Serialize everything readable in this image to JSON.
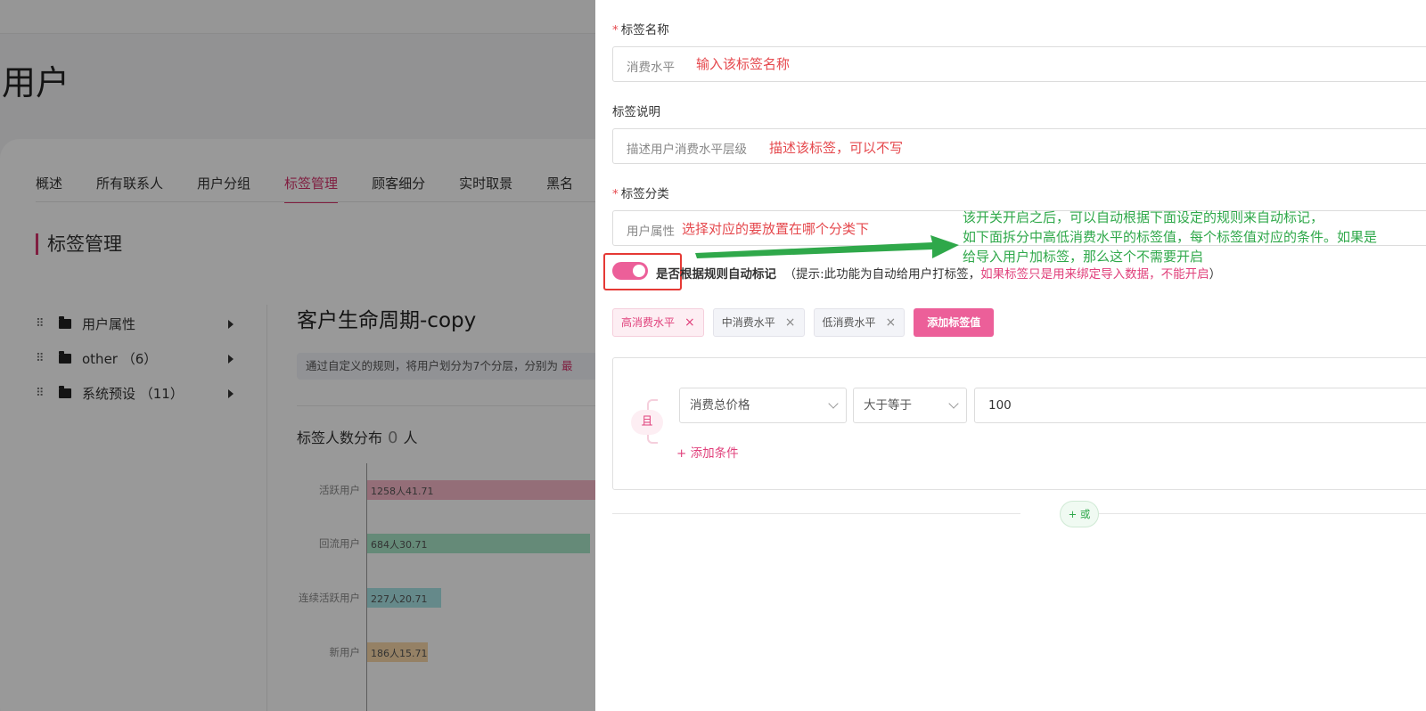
{
  "background": {
    "page_title": "用户",
    "tabs": [
      "概述",
      "所有联系人",
      "用户分组",
      "标签管理",
      "顾客细分",
      "实时取景",
      "黑名"
    ],
    "active_tab": "标签管理",
    "section_title": "标签管理",
    "tree": [
      {
        "label": "用户属性"
      },
      {
        "label": "other （6）"
      },
      {
        "label": "系统预设 （11）"
      }
    ],
    "detail_title": "客户生命周期-copy",
    "detail_desc_prefix": "通过自定义的规则，将用户划分为7个分层，分别为",
    "detail_desc_suffix": "最",
    "dist_label": "标签人数分布",
    "dist_count": "0",
    "dist_unit": "人"
  },
  "chart_data": {
    "type": "bar",
    "orientation": "horizontal",
    "categories": [
      "活跃用户",
      "回流用户",
      "连续活跃用户",
      "新用户"
    ],
    "values": [
      1258,
      684,
      227,
      186
    ],
    "data_labels": [
      "1258人41.71",
      "684人30.71",
      "227人20.71",
      "186人15.71"
    ],
    "colors": [
      "#f7b8c8",
      "#a8e6c9",
      "#a8e4e6",
      "#f8d7a8"
    ]
  },
  "drawer": {
    "name_label": "标签名称",
    "name_placeholder": "消费水平",
    "name_note": "输入该标签名称",
    "desc_label": "标签说明",
    "desc_placeholder": "描述用户消费水平层级",
    "desc_note": "描述该标签，可以不写",
    "category_label": "标签分类",
    "category_value": "用户属性",
    "category_note": "选择对应的要放置在哪个分类下",
    "green_note": [
      "该开关开启之后，可以自动根据下面设定的规则来自动标记，",
      "如下面拆分中高低消费水平的标签值，每个标签值对应的条件。如果是",
      "给导入用户加标签，那么这个不需要开启"
    ],
    "toggle_on": true,
    "toggle_label": "是否根据规则自动标记",
    "toggle_hint_prefix": "（提示:此功能为自动给用户打标签，",
    "toggle_hint_pink": "如果标签只是用来绑定导入数据，不能开启",
    "toggle_hint_suffix": "）",
    "tag_values": [
      {
        "label": "高消费水平",
        "selected": true
      },
      {
        "label": "中消费水平",
        "selected": false
      },
      {
        "label": "低消费水平",
        "selected": false
      }
    ],
    "add_tag_label": "添加标签值",
    "and_label": "且",
    "condition": {
      "field": "消费总价格",
      "operator": "大于等于",
      "value": "100"
    },
    "add_condition_label": "+ 添加条件",
    "or_label": "+ 或",
    "accent_color": "#ec5f99",
    "note_red_color": "#e5484d",
    "note_green_color": "#2fa84a"
  }
}
